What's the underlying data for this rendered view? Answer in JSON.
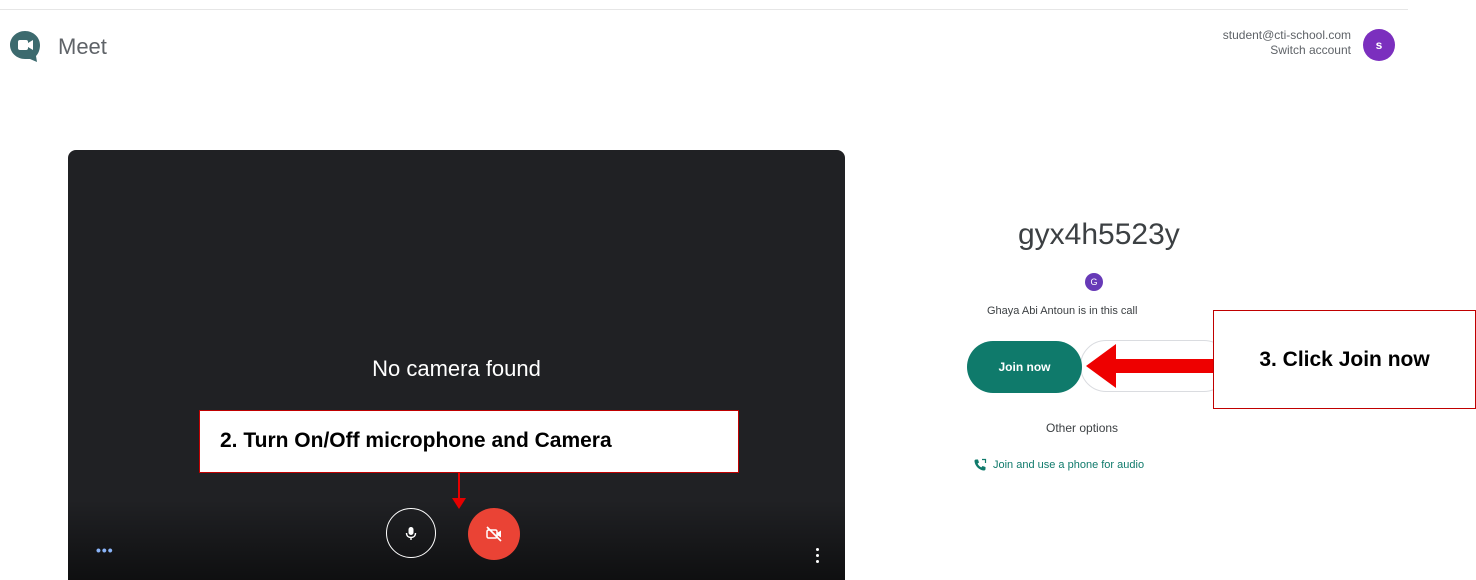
{
  "header": {
    "app_name": "Meet",
    "account_email": "student@cti-school.com",
    "switch_account": "Switch account",
    "avatar_initial": "s"
  },
  "preview": {
    "status_text": "No camera found",
    "more_options_left": "•••",
    "mic_icon": "microphone-icon",
    "camera_icon": "camera-off-icon"
  },
  "panel": {
    "meeting_code": "gyx4h5523y",
    "participant_initial": "G",
    "in_call_text": "Ghaya Abi Antoun is in this call",
    "join_button": "Join now",
    "other_options": "Other options",
    "phone_audio_link": "Join and use a phone for audio"
  },
  "annotations": {
    "step2": "2. Turn On/Off microphone and Camera",
    "step3": "3. Click Join now"
  },
  "colors": {
    "join_button": "#0f7a6b",
    "camera_off": "#ea4335",
    "avatar": "#7b2fbe",
    "annotation_red": "#e60000"
  }
}
